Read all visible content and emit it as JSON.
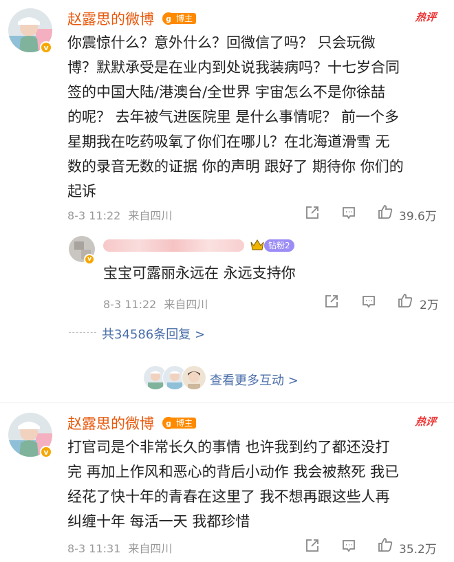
{
  "post1": {
    "username": "赵露思的微博",
    "badge": "博主",
    "hot_label": "热评",
    "lines": [
      "你震惊什么？意外什么？回微信了吗？ 只会玩微",
      "博？默默承受是在业内到处说我装病吗？十七岁合同",
      "签的中国大陆/港澳台/全世界  宇宙怎么不是你徐喆",
      "的呢？ 去年被气进医院里 是什么事情呢？ 前一个多",
      "星期我在吃药吸氧了你们在哪儿？在北海道滑雪 无",
      "数的录音无数的证据 你的声明 跟好了 期待你 你们的",
      "起诉"
    ],
    "time": "8-3 11:22",
    "location": "来自四川",
    "likes": "39.6万"
  },
  "reply": {
    "fan_badge": "钻粉2",
    "text": "宝宝可露丽永远在 永远支持你",
    "time": "8-3 11:22",
    "location": "来自四川",
    "likes": "2万"
  },
  "replies_link": "共34586条回复 >",
  "more_interactions": "查看更多互动 >",
  "post2": {
    "username": "赵露思的微博",
    "badge": "博主",
    "hot_label": "热评",
    "lines": [
      "打官司是个非常长久的事情 也许我到约了都还没打",
      "完 再加上作风和恶心的背后小动作 我会被熬死 我已",
      "经花了快十年的青春在这里了 我不想再跟这些人再",
      "纠缠十年 每活一天 我都珍惜"
    ],
    "time": "8-3 11:31",
    "location": "来自四川",
    "likes": "35.2万"
  },
  "colors": {
    "username": "#e8590c",
    "hot": "#e33333",
    "link": "#4a6ea9",
    "meta": "#999999"
  }
}
